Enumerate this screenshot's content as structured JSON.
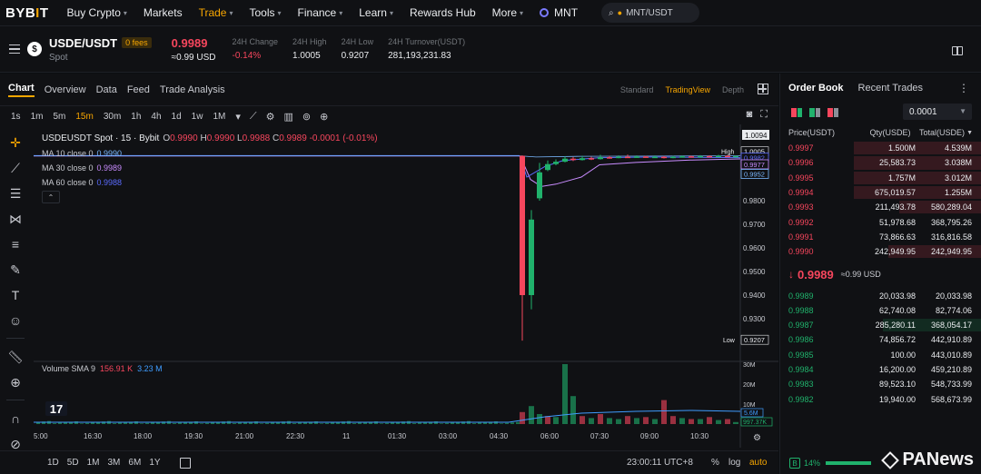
{
  "nav": {
    "logo_a": "BYB",
    "logo_b": "I",
    "logo_c": "T",
    "items": [
      {
        "label": "Buy Crypto",
        "chevron": true
      },
      {
        "label": "Markets",
        "chevron": false
      },
      {
        "label": "Trade",
        "chevron": true,
        "active": true
      },
      {
        "label": "Tools",
        "chevron": true
      },
      {
        "label": "Finance",
        "chevron": true
      },
      {
        "label": "Learn",
        "chevron": true
      },
      {
        "label": "Rewards Hub",
        "chevron": false
      },
      {
        "label": "More",
        "chevron": true
      }
    ],
    "mnt_label": "MNT",
    "search_value": "MNT/USDT"
  },
  "symbol": {
    "pair": "USDE/USDT",
    "fees_badge": "0 fees",
    "market": "Spot",
    "last_price": "0.9989",
    "last_price_usd": "≈0.99 USD",
    "stats": [
      {
        "label": "24H Change",
        "value": "-0.14%",
        "negative": true
      },
      {
        "label": "24H High",
        "value": "1.0005"
      },
      {
        "label": "24H Low",
        "value": "0.9207"
      },
      {
        "label": "24H Turnover(USDT)",
        "value": "281,193,231.83"
      }
    ]
  },
  "chart_tabs": [
    "Chart",
    "Overview",
    "Data",
    "Feed",
    "Trade Analysis"
  ],
  "view_modes": [
    "Standard",
    "TradingView",
    "Depth"
  ],
  "active_view": "TradingView",
  "timeframes": [
    "1s",
    "1m",
    "5m",
    "15m",
    "30m",
    "1h",
    "4h",
    "1d",
    "1w",
    "1M"
  ],
  "active_timeframe": "15m",
  "legend": {
    "title": "USDEUSDT Spot · 15 · Bybit",
    "o": "0.9990",
    "h": "0.9990",
    "l": "0.9988",
    "c": "0.9989",
    "change": "-0.0001 (-0.01%)",
    "ma": [
      {
        "label": "MA 10 close 0",
        "value": "0.9990",
        "color": "#7ab8ff"
      },
      {
        "label": "MA 30 close 0",
        "value": "0.9989",
        "color": "#c98cff"
      },
      {
        "label": "MA 60 close 0",
        "value": "0.9988",
        "color": "#5b6cff"
      }
    ]
  },
  "volume_legend": {
    "label": "Volume SMA 9",
    "v1": "156.91 K",
    "v2": "3.23 M"
  },
  "price_axis": {
    "top_label": "1.0094",
    "ticks": [
      "0.9800",
      "0.9700",
      "0.9600",
      "0.9500",
      "0.9400",
      "0.9300"
    ],
    "high_label": "High",
    "high_value": "1.0005",
    "low_label": "Low",
    "low_value": "0.9207",
    "markers": [
      "0.9982",
      "0.9977",
      "0.9952"
    ],
    "volume_ticks": [
      "30M",
      "20M",
      "10M"
    ],
    "volume_markers": [
      "5.6M",
      "997.37K"
    ]
  },
  "time_axis": [
    "5:00",
    "16:30",
    "18:00",
    "19:30",
    "21:00",
    "22:30",
    "11",
    "01:30",
    "03:00",
    "04:30",
    "06:00",
    "07:30",
    "09:00",
    "10:30"
  ],
  "ranges": [
    "1D",
    "5D",
    "1M",
    "3M",
    "6M",
    "1Y"
  ],
  "clock": "23:00:11 UTC+8",
  "scale_pct": "%",
  "scale_log": "log",
  "scale_auto": "auto",
  "orderbook": {
    "tabs": [
      "Order Book",
      "Recent Trades"
    ],
    "precision": "0.0001",
    "headers": [
      "Price(USDT)",
      "Qty(USDE)",
      "Total(USDE)"
    ],
    "asks": [
      {
        "price": "0.9997",
        "qty": "1.500M",
        "total": "4.539M",
        "depth": 1.0
      },
      {
        "price": "0.9996",
        "qty": "25,583.73",
        "total": "3.038M",
        "depth": 1.0
      },
      {
        "price": "0.9995",
        "qty": "1.757M",
        "total": "3.012M",
        "depth": 1.0
      },
      {
        "price": "0.9994",
        "qty": "675,019.57",
        "total": "1.255M",
        "depth": 1.0
      },
      {
        "price": "0.9993",
        "qty": "211,493.78",
        "total": "580,289.04",
        "depth": 0.64
      },
      {
        "price": "0.9992",
        "qty": "51,978.68",
        "total": "368,795.26",
        "depth": 0.0
      },
      {
        "price": "0.9991",
        "qty": "73,866.63",
        "total": "316,816.58",
        "depth": 0.0
      },
      {
        "price": "0.9990",
        "qty": "242,949.95",
        "total": "242,949.95",
        "depth": 0.73
      }
    ],
    "mid_price": "0.9989",
    "mid_usd": "≈0.99 USD",
    "bids": [
      {
        "price": "0.9989",
        "qty": "20,033.98",
        "total": "20,033.98",
        "depth": 0.0
      },
      {
        "price": "0.9988",
        "qty": "62,740.08",
        "total": "82,774.06",
        "depth": 0.0
      },
      {
        "price": "0.9987",
        "qty": "285,280.11",
        "total": "368,054.17",
        "depth": 0.77
      },
      {
        "price": "0.9986",
        "qty": "74,856.72",
        "total": "442,910.89",
        "depth": 0.0
      },
      {
        "price": "0.9985",
        "qty": "100.00",
        "total": "443,010.89",
        "depth": 0.0
      },
      {
        "price": "0.9984",
        "qty": "16,200.00",
        "total": "459,210.89",
        "depth": 0.0
      },
      {
        "price": "0.9983",
        "qty": "89,523.10",
        "total": "548,733.99",
        "depth": 0.0
      },
      {
        "price": "0.9982",
        "qty": "19,940.00",
        "total": "568,673.99",
        "depth": 0.0
      }
    ],
    "buy_badge": "B",
    "buy_pct": "14%"
  },
  "watermark": "PANews",
  "tv_logo": "17",
  "colors": {
    "up": "#20b26c",
    "down": "#f6465d",
    "accent": "#f7a600",
    "bg": "#101114"
  }
}
